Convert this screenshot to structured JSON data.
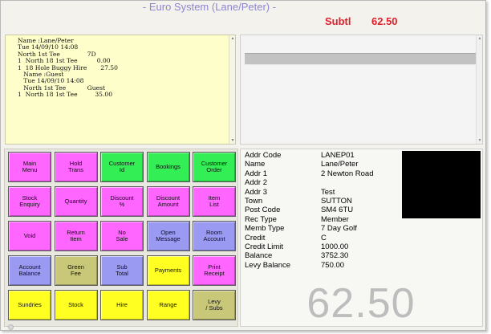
{
  "window": {
    "title": "- Euro System (Lane/Peter) -"
  },
  "subtotal": {
    "label": "Subtl",
    "value": "62.50"
  },
  "receipt": {
    "lines": [
      "Name :Lane/Peter",
      "Tue 14/09/10 14:08",
      "North 1st Tee              7D",
      "1  North 18 1st Tee          0.00",
      "1  18 Hole Buggy Hire       27.50",
      "   Name :Guest",
      "   Tue 14/09/10 14:08",
      "   North 1st Tee           Guest",
      "1  North 18 1st Tee         35.00"
    ]
  },
  "keypad": {
    "keys": [
      {
        "label": "Main\nMenu",
        "color": "#ff66ff"
      },
      {
        "label": "Hold\nTrans",
        "color": "#ff66ff"
      },
      {
        "label": "Customer\nId",
        "color": "#33ee55"
      },
      {
        "label": "Bookings",
        "color": "#33ee55"
      },
      {
        "label": "Customer\nOrder",
        "color": "#33ee55"
      },
      {
        "label": "Stock\nEnquiry",
        "color": "#ff66ff"
      },
      {
        "label": "Quantity",
        "color": "#ff66ff"
      },
      {
        "label": "Discount\n%",
        "color": "#ff66ff"
      },
      {
        "label": "Discount\nAmount",
        "color": "#ff66ff"
      },
      {
        "label": "Item\nList",
        "color": "#ff66ff"
      },
      {
        "label": "Void",
        "color": "#ff66ff"
      },
      {
        "label": "Return\nItem",
        "color": "#ff66ff"
      },
      {
        "label": "No\nSale",
        "color": "#ff66ff"
      },
      {
        "label": "Open\nMessage",
        "color": "#9a9af2"
      },
      {
        "label": "Room\nAccount",
        "color": "#9a9af2"
      },
      {
        "label": "Account\nBalance",
        "color": "#9a9af2"
      },
      {
        "label": "Green\nFee",
        "color": "#c8c878"
      },
      {
        "label": "Sub\nTotal",
        "color": "#9a9af2"
      },
      {
        "label": "Payments",
        "color": "#ffff22"
      },
      {
        "label": "Print\nReceipt",
        "color": "#ff66ff"
      },
      {
        "label": "Sundries",
        "color": "#ffff22"
      },
      {
        "label": "Stock",
        "color": "#ffff22"
      },
      {
        "label": "Hire",
        "color": "#ffff22"
      },
      {
        "label": "Range",
        "color": "#ffff22"
      },
      {
        "label": "Levy\n/ Subs",
        "color": "#c8c878"
      }
    ]
  },
  "account": {
    "fields": [
      {
        "label": "Addr Code",
        "value": "LANEP01"
      },
      {
        "label": "Name",
        "value": "Lane/Peter"
      },
      {
        "label": "Addr 1",
        "value": "2 Newton Road"
      },
      {
        "label": "Addr 2",
        "value": ""
      },
      {
        "label": "Addr 3",
        "value": "Test"
      },
      {
        "label": "Town",
        "value": "SUTTON"
      },
      {
        "label": "Post Code",
        "value": "SM4 6TU"
      },
      {
        "label": "Rec Type",
        "value": "Member"
      },
      {
        "label": "Memb Type",
        "value": "7 Day Golf"
      },
      {
        "label": "Credit",
        "value": "C"
      },
      {
        "label": "Credit Limit",
        "value": "1000.00"
      },
      {
        "label": "Balance",
        "value": "3752.30"
      },
      {
        "label": "Levy Balance",
        "value": "750.00"
      }
    ],
    "big_total": "62.50"
  }
}
